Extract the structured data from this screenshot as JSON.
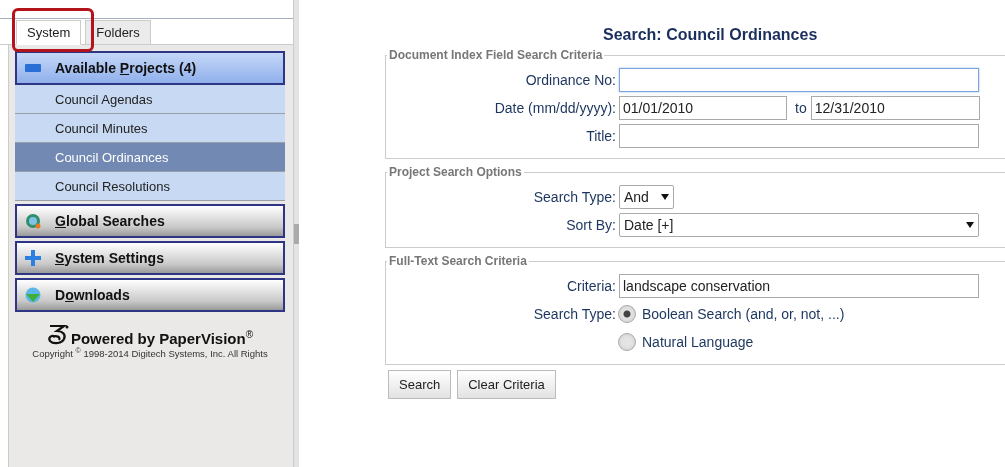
{
  "tabs": [
    {
      "label": "System",
      "selected": true
    },
    {
      "label": "Folders",
      "selected": false
    }
  ],
  "annotation": {
    "kind": "highlight"
  },
  "sidebar": {
    "sections": [
      {
        "kind": "minus",
        "before": "Available ",
        "mnemonic": "P",
        "after": "rojects (4)",
        "expanded": true,
        "items": [
          {
            "label": "Council Agendas",
            "selected": false
          },
          {
            "label": "Council Minutes",
            "selected": false
          },
          {
            "label": "Council Ordinances",
            "selected": true
          },
          {
            "label": "Council Resolutions",
            "selected": false
          }
        ]
      },
      {
        "kind": "globe",
        "mnemonic": "G",
        "after": "lobal Searches",
        "expanded": false
      },
      {
        "kind": "plus",
        "mnemonic": "S",
        "after": "ystem Settings",
        "expanded": false
      },
      {
        "kind": "download",
        "before": "D",
        "mnemonic": "o",
        "after": "wnloads",
        "expanded": false
      }
    ],
    "powered_by": "Powered by PaperVision$^{®}$",
    "copyright": "Copyright $^{©}$ 1998-2014 Digitech Systems, Inc. All Rights"
  },
  "main": {
    "title": "Search: Council Ordinances",
    "index_fields": {
      "legend": "Document Index Field Search Criteria",
      "ordinance_no": {
        "label": "Ordinance No:"
      },
      "date": {
        "label": "Date (mm/dd/yyyy):",
        "from": "01/01/2010",
        "to_label": "to",
        "to": "12/31/2010"
      },
      "title": {
        "label": "Title:"
      }
    },
    "project_options": {
      "legend": "Project Search Options",
      "search_type": {
        "label": "Search Type:",
        "value": "And"
      },
      "sort_by": {
        "label": "Sort By:",
        "value": "Date [+]"
      }
    },
    "full_text": {
      "legend": "Full-Text Search Criteria",
      "criteria": {
        "label": "Criteria:",
        "value": "landscape conservation"
      },
      "search_type_label": "Search Type:",
      "options": [
        {
          "label": "Boolean Search (and, or, not, ...)",
          "selected": true
        },
        {
          "label": "Natural Language",
          "selected": false
        }
      ]
    },
    "buttons": [
      "Search",
      "Clear Criteria"
    ]
  }
}
